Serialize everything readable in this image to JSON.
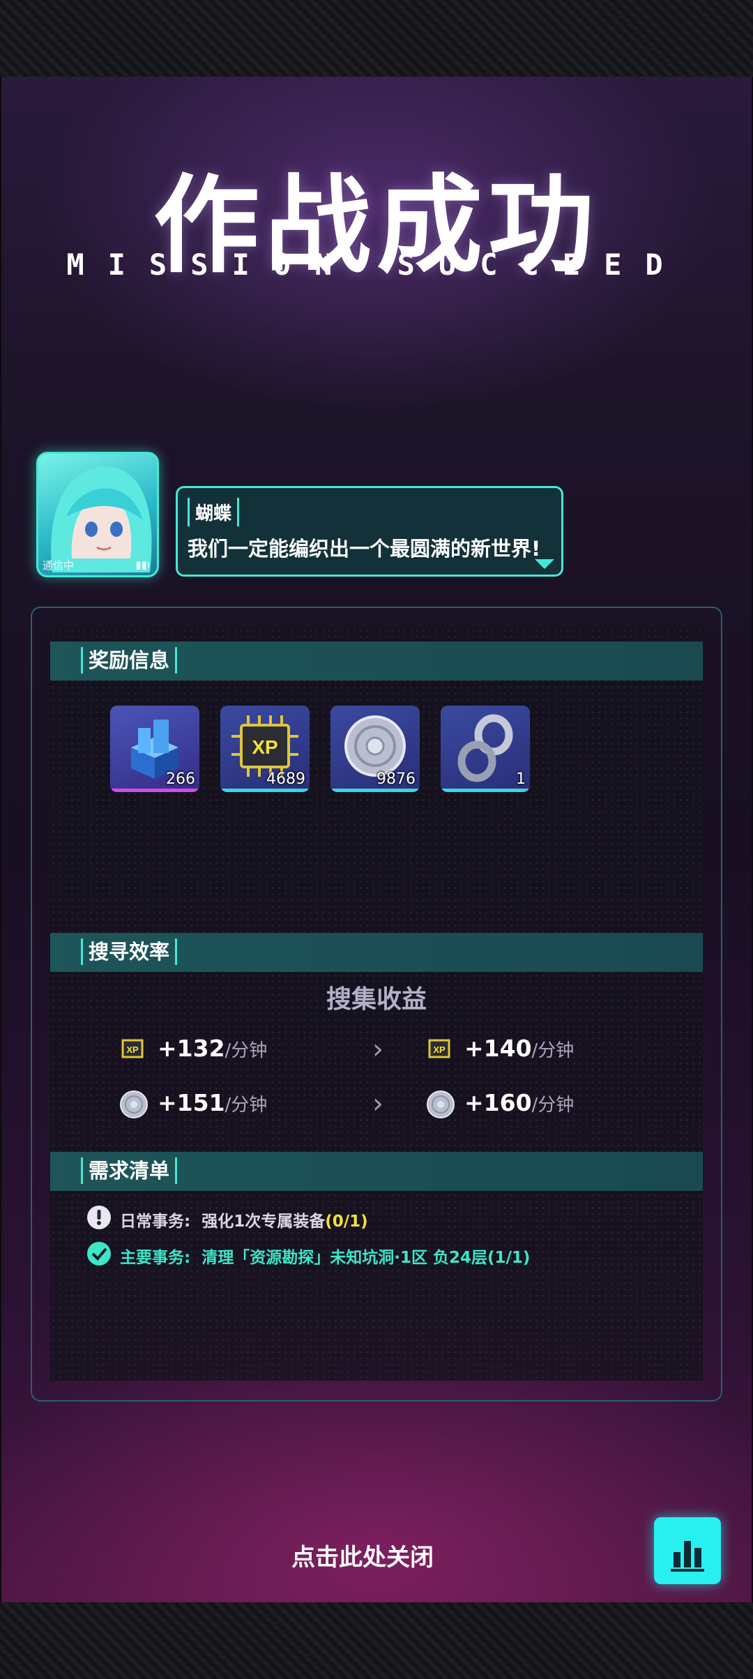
{
  "header": {
    "title_cn": "作战成功",
    "title_en": "MISSION SUCCEED"
  },
  "dialog": {
    "avatar_status": "通信中",
    "speaker": "蝴蝶",
    "message": "我们一定能编织出一个最圆满的新世界!"
  },
  "rewards": {
    "section_label": "奖励信息",
    "items": [
      {
        "icon": "blue-blocks-icon",
        "count": "266",
        "rarity_color": "#d24ce8"
      },
      {
        "icon": "xp-chip-icon",
        "count": "4689",
        "rarity_color": "#38d6e6"
      },
      {
        "icon": "silver-disc-icon",
        "count": "9876",
        "rarity_color": "#38d6e6"
      },
      {
        "icon": "infinity-ring-icon",
        "count": "1",
        "rarity_color": "#38d6e6"
      }
    ]
  },
  "efficiency": {
    "section_label": "搜寻效率",
    "subtitle": "搜集收益",
    "rows": [
      {
        "icon": "xp-chip-icon",
        "current": "+132",
        "next": "+140",
        "unit": "/分钟"
      },
      {
        "icon": "silver-disc-icon",
        "current": "+151",
        "next": "+160",
        "unit": "/分钟"
      }
    ]
  },
  "requirements": {
    "section_label": "需求清单",
    "tasks": [
      {
        "status": "pending",
        "type": "日常事务:",
        "desc": "强化1次专属装备",
        "progress": "(0/1)"
      },
      {
        "status": "done",
        "type": "主要事务:",
        "desc": "清理「资源勘探」未知坑洞·1区 负24层",
        "progress": "(1/1)"
      }
    ]
  },
  "footer": {
    "close_label": "点击此处关闭",
    "stats_button": "bar-chart-icon"
  },
  "colors": {
    "accent_cyan": "#45e8d6",
    "progress_yellow": "#f2e23a",
    "done_green": "#3ce6c8"
  }
}
